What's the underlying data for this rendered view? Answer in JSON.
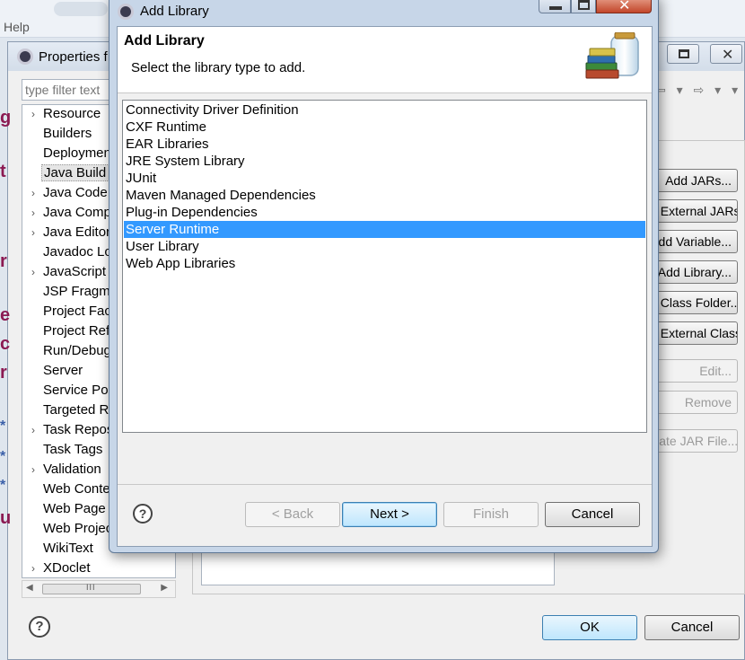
{
  "background": {
    "menubar": {
      "help_label": "Help"
    },
    "properties_window": {
      "title": "Properties f",
      "filter_placeholder": "type filter text",
      "tree_items": [
        {
          "label": "Resource",
          "expandable": true
        },
        {
          "label": "Builders",
          "expandable": false
        },
        {
          "label": "Deployment",
          "expandable": false
        },
        {
          "label": "Java Build Path",
          "expandable": false,
          "selected": true
        },
        {
          "label": "Java Code Style",
          "expandable": true
        },
        {
          "label": "Java Compiler",
          "expandable": true
        },
        {
          "label": "Java Editor",
          "expandable": true
        },
        {
          "label": "Javadoc Location",
          "expandable": false
        },
        {
          "label": "JavaScript",
          "expandable": true
        },
        {
          "label": "JSP Fragment",
          "expandable": false
        },
        {
          "label": "Project Facets",
          "expandable": false
        },
        {
          "label": "Project References",
          "expandable": false
        },
        {
          "label": "Run/Debug Settings",
          "expandable": false
        },
        {
          "label": "Server",
          "expandable": false
        },
        {
          "label": "Service Policies",
          "expandable": false
        },
        {
          "label": "Targeted Runtimes",
          "expandable": false
        },
        {
          "label": "Task Repository",
          "expandable": true
        },
        {
          "label": "Task Tags",
          "expandable": false
        },
        {
          "label": "Validation",
          "expandable": true
        },
        {
          "label": "Web Content Settings",
          "expandable": false
        },
        {
          "label": "Web Page Editor",
          "expandable": false
        },
        {
          "label": "Web Project Settings",
          "expandable": false
        },
        {
          "label": "WikiText",
          "expandable": false
        },
        {
          "label": "XDoclet",
          "expandable": true
        }
      ],
      "scroll_thumb_glyph": "III",
      "nav_arrows": "⇦ ▾ ⇨ ▾ ▾",
      "side_buttons": [
        {
          "label": "Add JARs...",
          "enabled": true
        },
        {
          "label": "Add External JARs...",
          "enabled": true
        },
        {
          "label": "Add Variable...",
          "enabled": true
        },
        {
          "label": "Add Library...",
          "enabled": true
        },
        {
          "label": "Add Class Folder...",
          "enabled": true
        },
        {
          "label": "Add External Class Folder...",
          "enabled": true
        },
        {
          "label": "Edit...",
          "enabled": false
        },
        {
          "label": "Remove",
          "enabled": false
        },
        {
          "label": "Migrate JAR File...",
          "enabled": false
        }
      ],
      "left_edge_glyphs": [
        "g",
        "t",
        "r",
        "e",
        "c",
        "r",
        "*",
        "*",
        "*",
        "u"
      ],
      "ok_label": "OK",
      "cancel_label": "Cancel"
    }
  },
  "dialog": {
    "title": "Add Library",
    "heading": "Add Library",
    "subheading": "Select the library type to add.",
    "libraries": [
      "Connectivity Driver Definition",
      "CXF Runtime",
      "EAR Libraries",
      "JRE System Library",
      "JUnit",
      "Maven Managed Dependencies",
      "Plug-in Dependencies",
      "Server Runtime",
      "User Library",
      "Web App Libraries"
    ],
    "selected_library": "Server Runtime",
    "buttons": {
      "back": "< Back",
      "next": "Next >",
      "finish": "Finish",
      "cancel": "Cancel"
    },
    "help_glyph": "?"
  },
  "icons": {
    "window_app_icon": "eclipse-icon",
    "library_icon": "library-jar-books-icon",
    "help_icon": "help-question-icon"
  }
}
